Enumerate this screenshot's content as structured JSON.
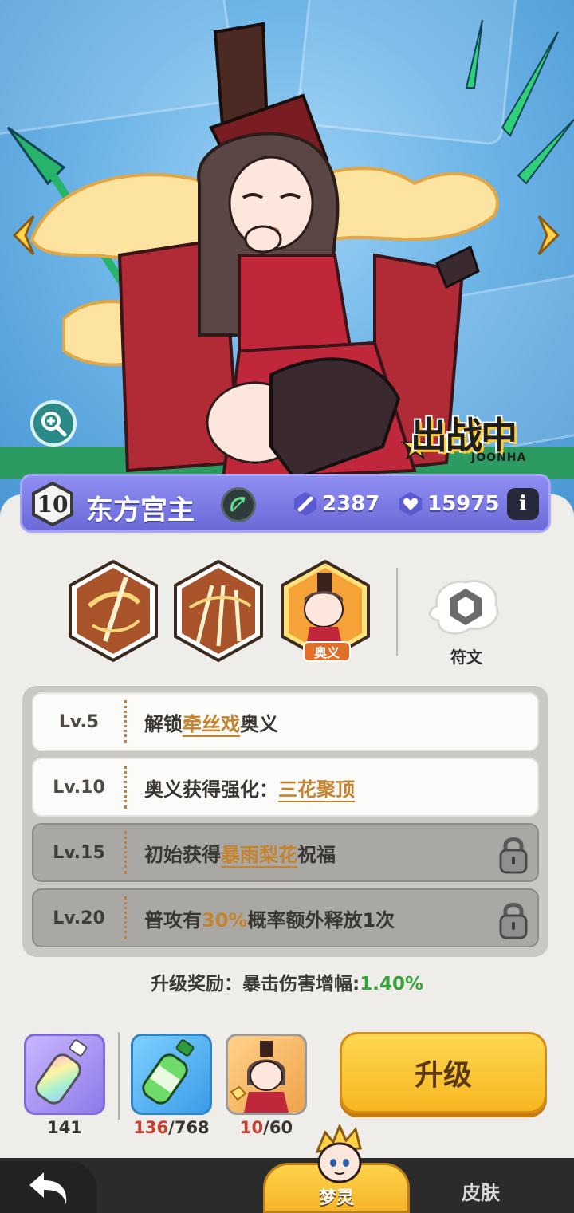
{
  "hero": {
    "status_text": "出战中",
    "status_sub": "JOONHA"
  },
  "character": {
    "level": "10",
    "name": "东方宫主",
    "attack": "2387",
    "health": "15975",
    "info_label": "i"
  },
  "skills": {
    "ultimate_tag": "奥义",
    "rune_label": "符文"
  },
  "unlocks": [
    {
      "level": "Lv.5",
      "prefix": "解锁",
      "highlight": "牵丝戏",
      "suffix": "奥义",
      "locked": false
    },
    {
      "level": "Lv.10",
      "prefix": "奥义获得强化：",
      "highlight": "三花聚顶",
      "suffix": "",
      "locked": false
    },
    {
      "level": "Lv.15",
      "prefix": "初始获得",
      "highlight": "暴雨梨花",
      "suffix": "祝福",
      "locked": true
    },
    {
      "level": "Lv.20",
      "prefix": "普攻有",
      "highlight": "30%",
      "suffix": "概率额外释放1次",
      "locked": true
    }
  ],
  "upgrade_reward": {
    "label": "升级奖励：暴击伤害增幅:",
    "value": "1.40%"
  },
  "items": [
    {
      "name": "rainbow-bottle",
      "count": "141",
      "have": "",
      "need": ""
    },
    {
      "name": "green-bottle",
      "count": "",
      "have": "136",
      "need": "/768"
    },
    {
      "name": "hero-shard",
      "count": "",
      "have": "10",
      "need": "/60"
    }
  ],
  "upgrade_button": "升级",
  "tabs": {
    "spirit": "梦灵",
    "skin": "皮肤"
  },
  "colors": {
    "accent_purple": "#7b7ae2",
    "highlight_orange": "#c4832e",
    "positive_green": "#3aa23a",
    "need_red": "#c83f30",
    "button_yellow": "#f7c33a"
  }
}
